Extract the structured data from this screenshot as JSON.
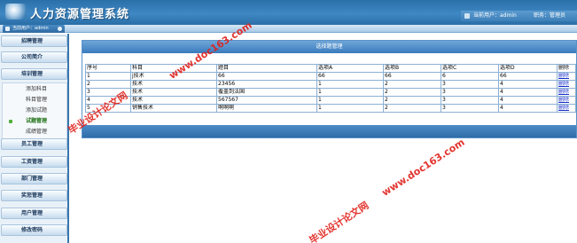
{
  "header": {
    "title": "人力资源管理系统",
    "current_user_label": "当前用户：admin",
    "role_label": "职务：管理员"
  },
  "subbar": {
    "label": "当前用户：admin"
  },
  "sidebar": {
    "items": [
      {
        "label": "招聘管理"
      },
      {
        "label": "公司简介"
      },
      {
        "label": "培训管理"
      },
      {
        "label": "员工管理"
      },
      {
        "label": "工资管理"
      },
      {
        "label": "部门管理"
      },
      {
        "label": "奖惩管理"
      },
      {
        "label": "用户管理"
      },
      {
        "label": "修改密码"
      }
    ],
    "training_sub": [
      {
        "label": "添加科目"
      },
      {
        "label": "科目管理"
      },
      {
        "label": "添加试题"
      },
      {
        "label": "试题管理"
      },
      {
        "label": "成绩管理"
      }
    ]
  },
  "panel": {
    "title": "选择题管理"
  },
  "table": {
    "headers": [
      "序号",
      "科目",
      "题目",
      "选项A",
      "选项B",
      "选项C",
      "选项D",
      "删除"
    ],
    "rows": [
      [
        "1",
        "j技术",
        "66",
        "66",
        "66",
        "6",
        "66",
        "删除"
      ],
      [
        "2",
        "技术",
        "23456",
        "1",
        "2",
        "3",
        "4",
        "删除"
      ],
      [
        "3",
        "技术",
        "覆盖到法国",
        "1",
        "2",
        "3",
        "4",
        "删除"
      ],
      [
        "4",
        "技术",
        "567567",
        "1",
        "2",
        "3",
        "4",
        "删除"
      ],
      [
        "5",
        "销售技术",
        "啊啊啊",
        "1",
        "2",
        "3",
        "4",
        "删除"
      ]
    ]
  },
  "watermarks": {
    "url": "www.doc163.com",
    "cn": "毕业设计论文网"
  },
  "colors": {
    "header": "#3f88c4",
    "panel_title": "#3a7bbd",
    "link": "#1830c8",
    "watermark": "#e0201a"
  }
}
